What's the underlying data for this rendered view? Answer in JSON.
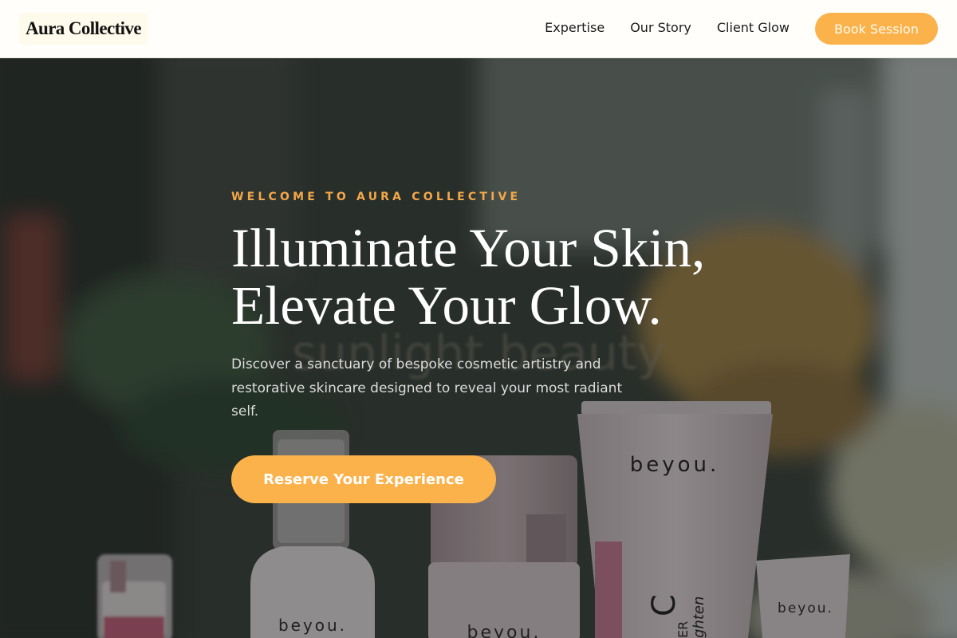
{
  "brand": {
    "name": "Aura Collective"
  },
  "nav": {
    "links": [
      {
        "label": "Expertise"
      },
      {
        "label": "Our Story"
      },
      {
        "label": "Client Glow"
      }
    ],
    "cta_label": "Book Session"
  },
  "hero": {
    "eyebrow": "WELCOME TO AURA COLLECTIVE",
    "headline_line1": "Illuminate Your Skin,",
    "headline_line2": "Elevate Your Glow.",
    "subtext": "Discover a sanctuary of bespoke cosmetic artistry and restorative skincare designed to reveal your most radiant self.",
    "cta_label": "Reserve Your Experience",
    "background": {
      "sign_text": "sunlight beauty",
      "product_brand": "beyou.",
      "tube_side_text": "ghten",
      "tube_side_text2": "ER"
    }
  },
  "colors": {
    "accent": "#fbb24b",
    "eyebrow": "#f3a849",
    "header_bg": "#fffefb",
    "hero_text": "#ffffff"
  }
}
